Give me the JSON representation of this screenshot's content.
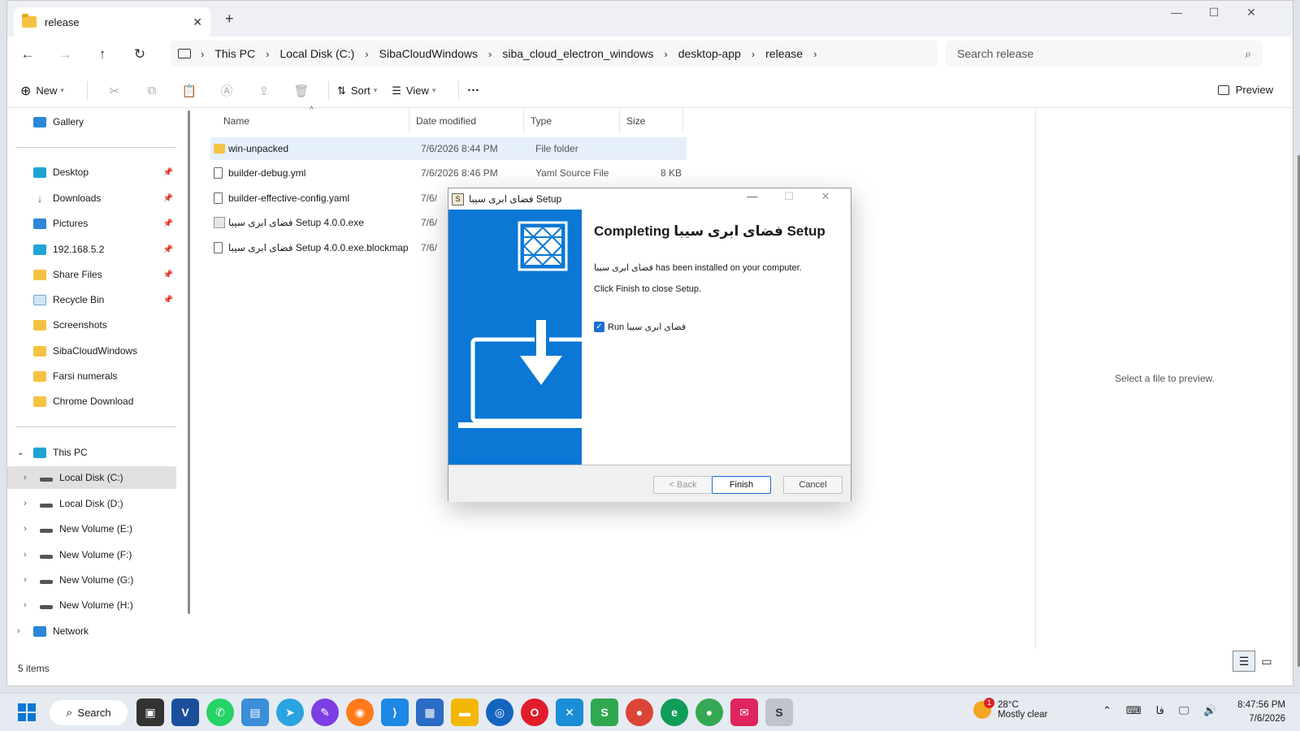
{
  "explorer": {
    "tab_title": "release",
    "breadcrumb": [
      "This PC",
      "Local Disk (C:)",
      "SibaCloudWindows",
      "siba_cloud_electron_windows",
      "desktop-app",
      "release"
    ],
    "search_placeholder": "Search release",
    "toolbar": {
      "new": "New",
      "sort": "Sort",
      "view": "View",
      "more": "···",
      "preview": "Preview"
    },
    "sidebar": {
      "gallery": "Gallery",
      "quick": [
        {
          "label": "Desktop",
          "pinned": true
        },
        {
          "label": "Downloads",
          "pinned": true
        },
        {
          "label": "Pictures",
          "pinned": true
        },
        {
          "label": "192.168.5.2",
          "pinned": true
        },
        {
          "label": "Share Files",
          "pinned": true
        },
        {
          "label": "Recycle Bin",
          "pinned": true
        },
        {
          "label": "Screenshots",
          "pinned": false
        },
        {
          "label": "SibaCloudWindows",
          "pinned": false
        },
        {
          "label": "Farsi numerals",
          "pinned": false
        },
        {
          "label": "Chrome Download",
          "pinned": false
        }
      ],
      "this_pc": "This PC",
      "drives": [
        "Local Disk (C:)",
        "Local Disk (D:)",
        "New Volume (E:)",
        "New Volume (F:)",
        "New Volume (G:)",
        "New Volume (H:)"
      ],
      "network": "Network"
    },
    "columns": {
      "name": "Name",
      "date": "Date modified",
      "type": "Type",
      "size": "Size"
    },
    "files": [
      {
        "name": "win-unpacked",
        "date": "7/6/2026 8:44 PM",
        "type": "File folder",
        "size": ""
      },
      {
        "name": "builder-debug.yml",
        "date": "7/6/2026 8:46 PM",
        "type": "Yaml Source File",
        "size": "8 KB"
      },
      {
        "name": "builder-effective-config.yaml",
        "date": "7/6/",
        "type": "",
        "size": ""
      },
      {
        "name": "فضای ابری سیبا Setup 4.0.0.exe",
        "date": "7/6/",
        "type": "",
        "size": ""
      },
      {
        "name": "فضای ابری سیبا Setup 4.0.0.exe.blockmap",
        "date": "7/6/",
        "type": "",
        "size": ""
      }
    ],
    "preview_text": "Select a file to preview.",
    "status": "5 items"
  },
  "dialog": {
    "title": "فضای ابری سیبا Setup",
    "heading": "Completing فضای ابری سیبا Setup",
    "line1": "فضای ابری سیبا has been installed on your computer.",
    "line2": "Click Finish to close Setup.",
    "checkbox_label": "Run فضای ابری سیبا",
    "checkbox_checked": true,
    "back": "< Back",
    "finish": "Finish",
    "cancel": "Cancel",
    "banner_color": "#0a78d4"
  },
  "taskbar": {
    "search": "Search",
    "weather_temp": "28°C",
    "weather_desc": "Mostly clear",
    "weather_badge": "1",
    "time": "8:47:56 PM",
    "date": "7/6/2026",
    "lang": "فا"
  }
}
